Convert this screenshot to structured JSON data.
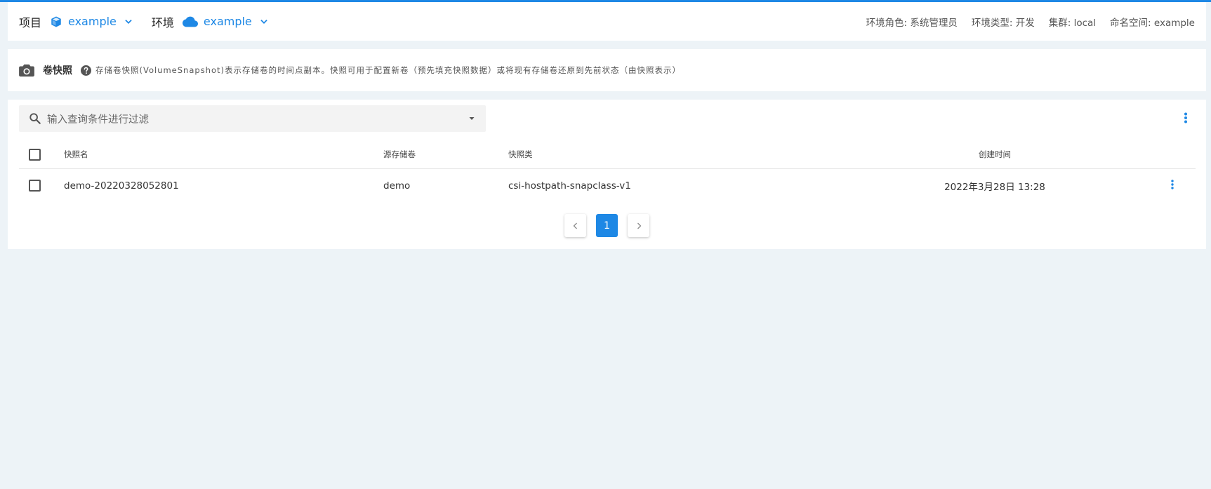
{
  "header": {
    "project_label": "项目",
    "project_value": "example",
    "env_label": "环境",
    "env_value": "example",
    "env_role": "环境角色: 系统管理员",
    "env_type": "环境类型: 开发",
    "cluster": "集群: local",
    "namespace": "命名空间: example"
  },
  "info": {
    "title": "卷快照",
    "description": "存储卷快照(VolumeSnapshot)表示存储卷的时间点副本。快照可用于配置新卷（预先填充快照数据）或将现有存储卷还原到先前状态（由快照表示）"
  },
  "search": {
    "placeholder": "输入查询条件进行过滤"
  },
  "table": {
    "columns": [
      "快照名",
      "源存储卷",
      "快照类",
      "创建时间"
    ],
    "rows": [
      {
        "name": "demo-20220328052801",
        "source": "demo",
        "class": "csi-hostpath-snapclass-v1",
        "created": "2022年3月28日 13:28"
      }
    ]
  },
  "pagination": {
    "current_page": "1"
  },
  "colors": {
    "accent": "#1e88e5",
    "background": "#edf3f7"
  }
}
